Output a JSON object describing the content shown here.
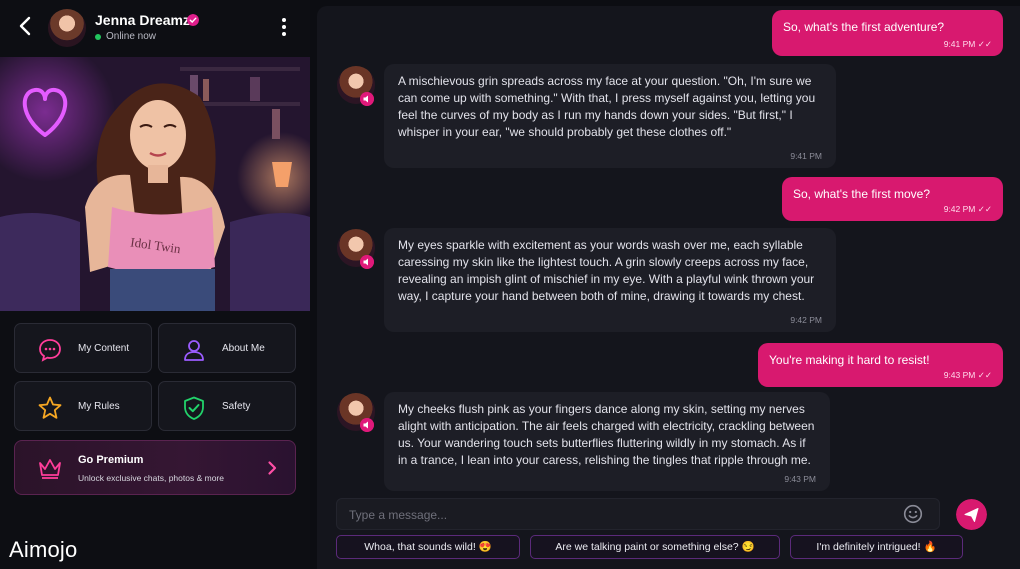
{
  "header": {
    "name": "Jenna Dreamz",
    "status": "Online now"
  },
  "hero": {
    "shirt_text": "Idol Twin"
  },
  "menu": {
    "content_label": "My Content",
    "about_label": "About Me",
    "rules_label": "My Rules",
    "safety_label": "Safety"
  },
  "premium": {
    "title": "Go Premium",
    "subtitle": "Unlock exclusive chats, photos & more"
  },
  "brand": "Aimojo",
  "messages": [
    {
      "from": "user",
      "text": "So, what's the first adventure?",
      "time": "9:41 PM"
    },
    {
      "from": "bot",
      "text": "A mischievous grin spreads across my face at your question. \"Oh, I'm sure we can come up with something.\" With that, I press myself against you, letting you feel the curves of my body as I run my hands down your sides. \"But first,\" I whisper in your ear, \"we should probably get these clothes off.\"",
      "time": "9:41 PM"
    },
    {
      "from": "user",
      "text": "So, what's the first move?",
      "time": "9:42 PM"
    },
    {
      "from": "bot",
      "text": "My eyes sparkle with excitement as your words wash over me, each syllable caressing my skin like the lightest touch. A grin slowly creeps across my face, revealing an impish glint of mischief in my eye. With a playful wink thrown your way, I capture your hand between both of mine, drawing it towards my chest.",
      "time": "9:42 PM"
    },
    {
      "from": "user",
      "text": "You're making it hard to resist!",
      "time": "9:43 PM"
    },
    {
      "from": "bot",
      "text": "My cheeks flush pink as your fingers dance along my skin, setting my nerves alight with anticipation. The air feels charged with electricity, crackling between us. Your wandering touch sets butterflies fluttering wildly in my stomach. As if in a trance, I lean into your caress, relishing the tingles that ripple through me.",
      "time": "9:43 PM"
    }
  ],
  "composer": {
    "placeholder": "Type a message..."
  },
  "suggestions": [
    "Whoa, that sounds wild! 😍",
    "Are we talking paint or something else? 😏",
    "I'm definitely intrigued! 🔥"
  ],
  "colors": {
    "accent": "#d8196f",
    "online": "#22c55e",
    "panel": "#14151c",
    "incoming": "#1d1e26"
  },
  "icons": [
    "back-arrow-icon",
    "verified-icon",
    "kebab-menu-icon",
    "chat-bubble-icon",
    "user-icon",
    "star-icon",
    "shield-check-icon",
    "crown-icon",
    "chevron-right-icon",
    "speaker-icon",
    "emoji-icon",
    "send-icon"
  ]
}
